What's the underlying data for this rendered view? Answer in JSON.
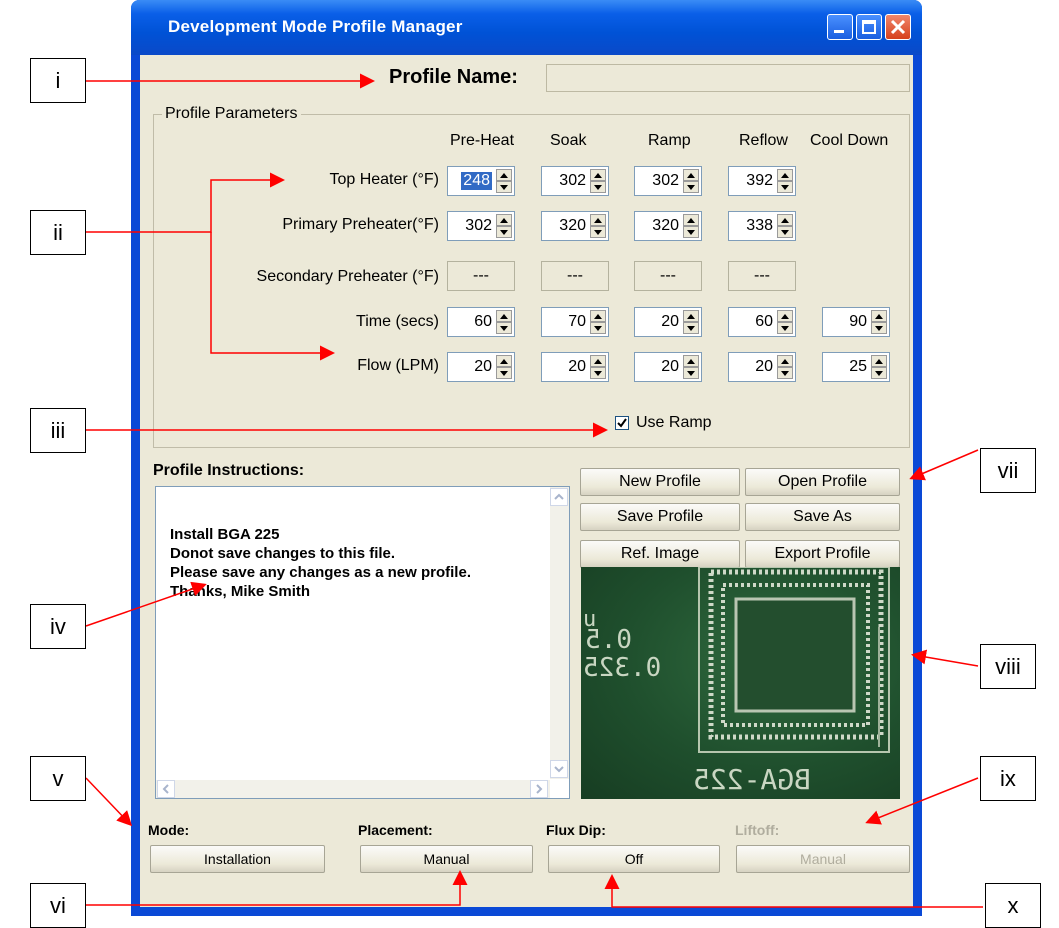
{
  "window": {
    "title": "Development Mode Profile Manager"
  },
  "profile_name": {
    "label": "Profile Name:",
    "value": ""
  },
  "parameters": {
    "group_label": "Profile Parameters",
    "columns": [
      "Pre-Heat",
      "Soak",
      "Ramp",
      "Reflow",
      "Cool Down"
    ],
    "rows": [
      {
        "label": "Top Heater  (°F)",
        "values": [
          "248",
          "302",
          "302",
          "392"
        ]
      },
      {
        "label": "Primary Preheater(°F)",
        "values": [
          "302",
          "320",
          "320",
          "338"
        ]
      },
      {
        "label": "Secondary Preheater (°F)",
        "values": [
          "---",
          "---",
          "---",
          "---"
        ]
      },
      {
        "label": "Time (secs)",
        "values": [
          "60",
          "70",
          "20",
          "60",
          "90"
        ]
      },
      {
        "label": "Flow (LPM)",
        "values": [
          "20",
          "20",
          "20",
          "20",
          "25"
        ]
      }
    ],
    "use_ramp": {
      "label": "Use Ramp",
      "checked": true
    }
  },
  "instructions": {
    "label": "Profile Instructions:",
    "lines": [
      "Install BGA 225",
      "Donot save changes to this file.",
      "Please save any changes as a new profile.",
      "Thanks, Mike Smith"
    ]
  },
  "buttons": {
    "new_profile": "New Profile",
    "open_profile": "Open Profile",
    "save_profile": "Save Profile",
    "save_as": "Save As",
    "ref_image": "Ref. Image",
    "export_profile": "Export Profile"
  },
  "reference_image": {
    "text_1": "0.5",
    "text_2": "0.325",
    "text_3": "BGA-225",
    "text_4": "u"
  },
  "footer": {
    "mode": {
      "label": "Mode:",
      "value": "Installation"
    },
    "placement": {
      "label": "Placement:",
      "value": "Manual"
    },
    "flux_dip": {
      "label": "Flux Dip:",
      "value": "Off"
    },
    "liftoff": {
      "label": "Liftoff:",
      "value": "Manual",
      "disabled": true
    }
  },
  "callouts": [
    "i",
    "ii",
    "iii",
    "iv",
    "v",
    "vi",
    "vii",
    "viii",
    "ix",
    "x"
  ],
  "colors": {
    "titlebar": "#0a5fe8",
    "client_bg": "#ece9d8",
    "arrow": "#ff0000"
  }
}
